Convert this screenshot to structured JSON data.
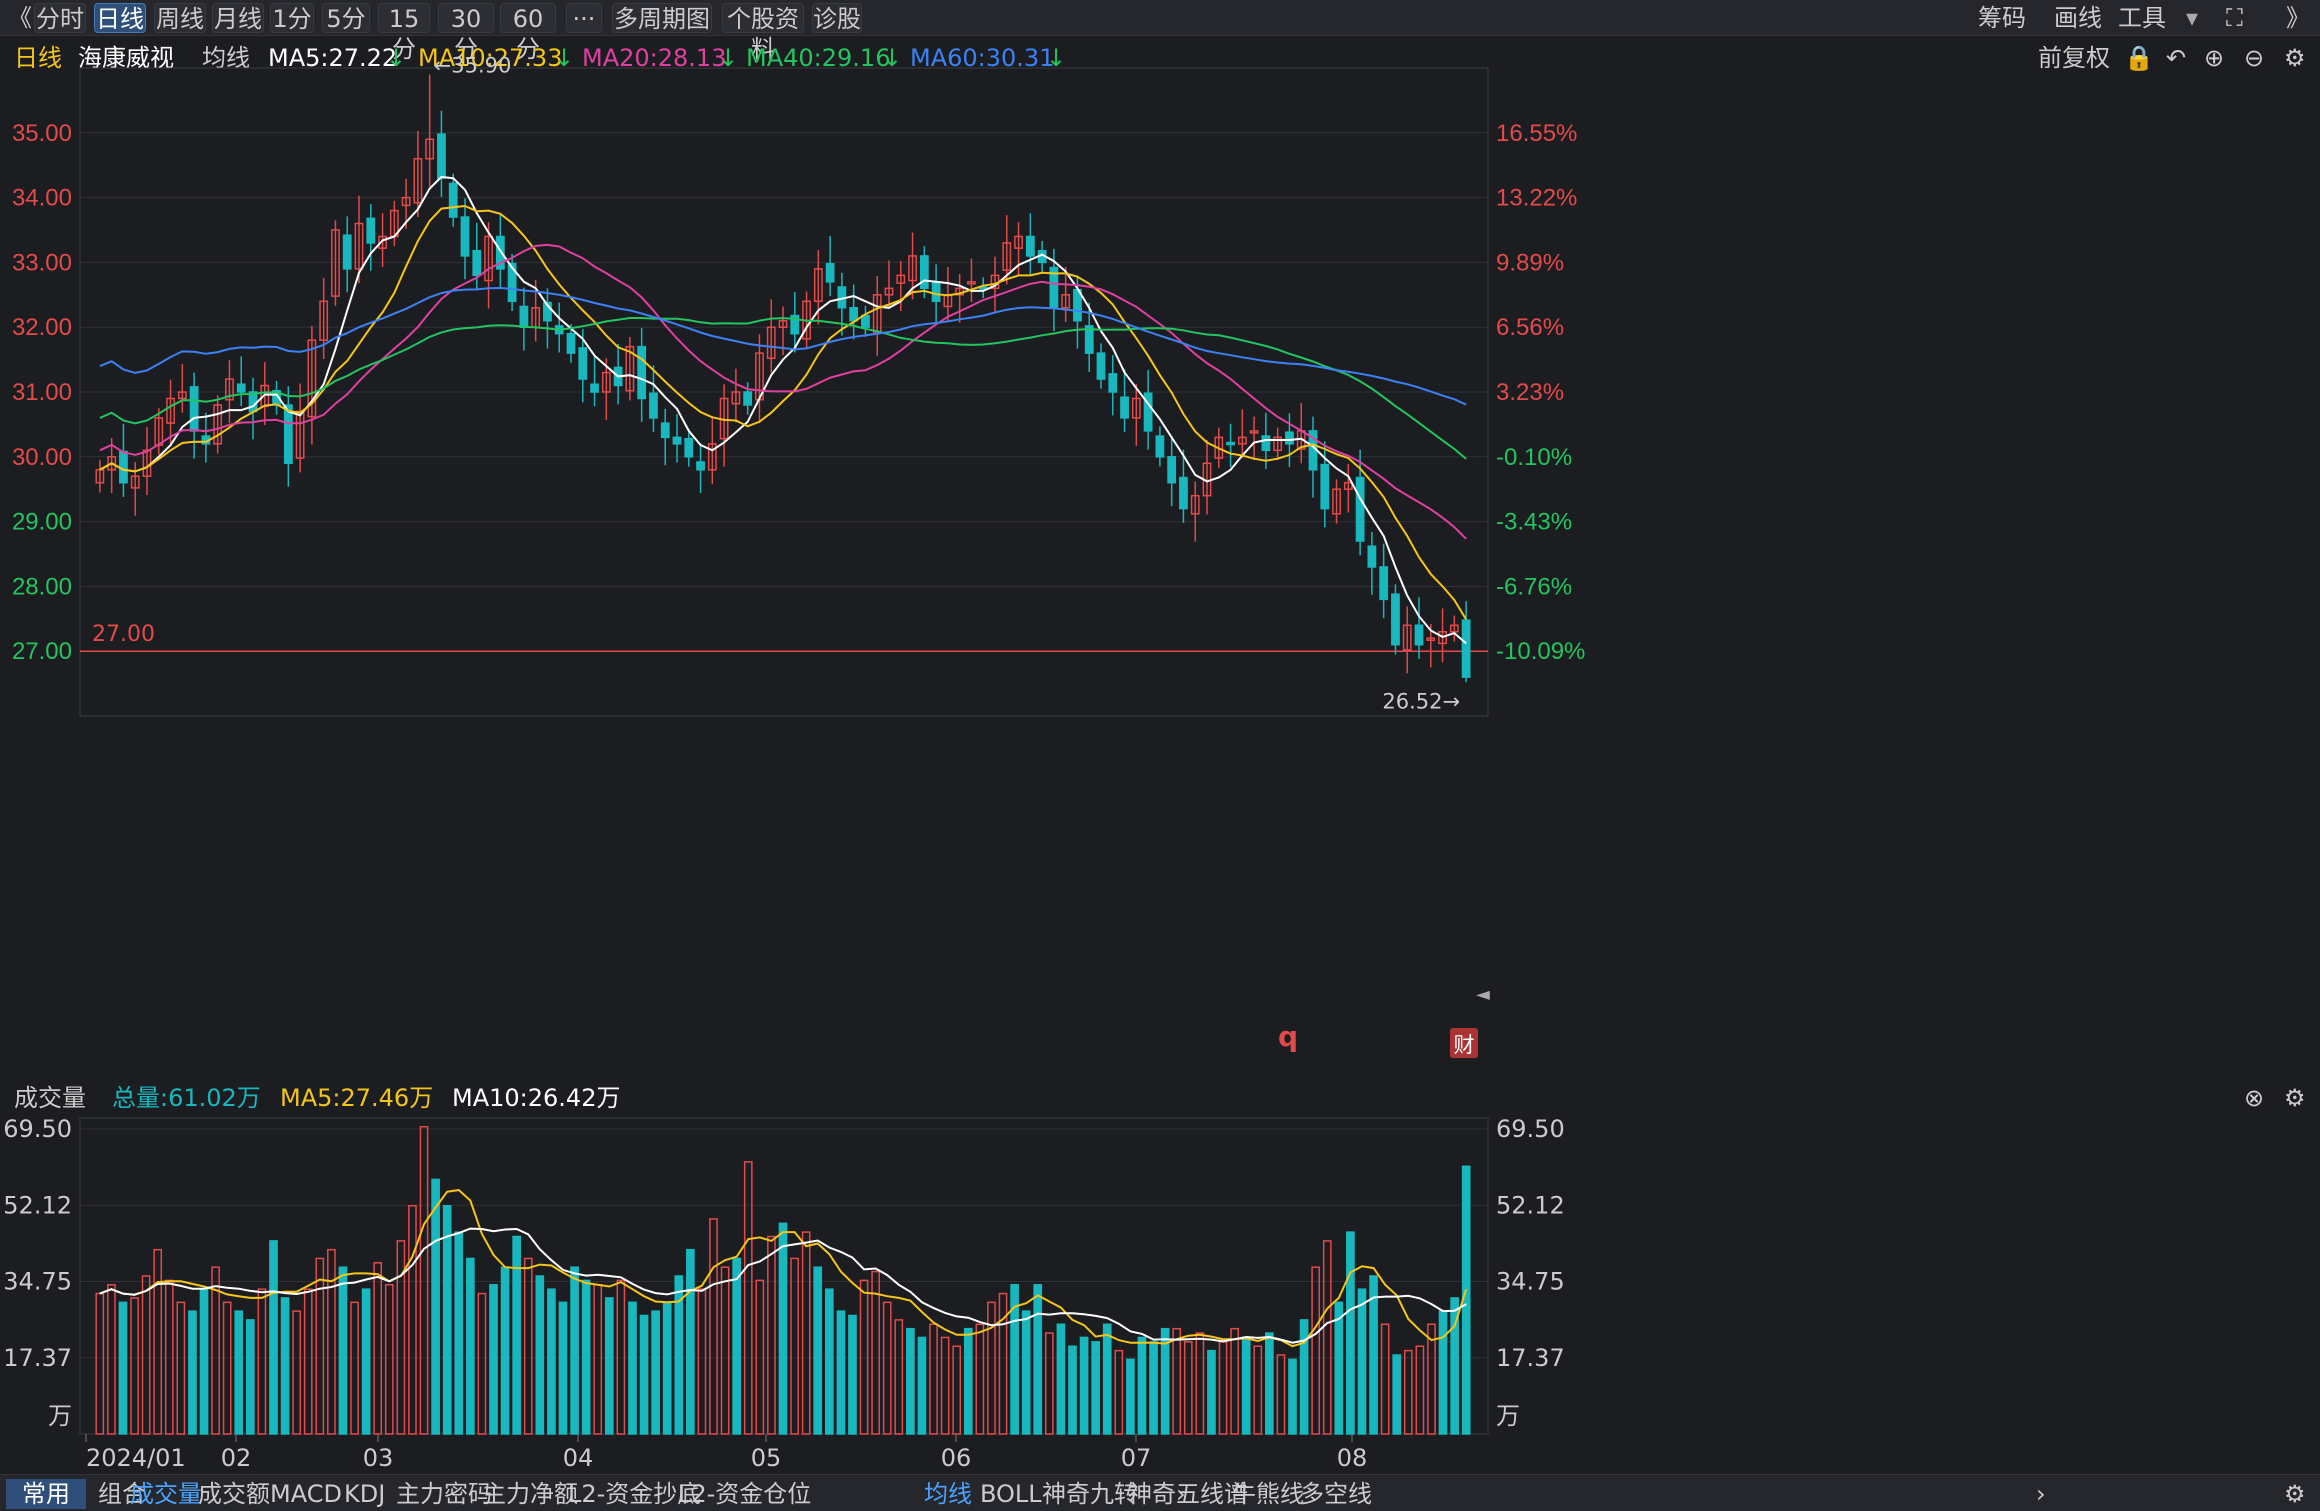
{
  "toolbar": {
    "tabs": [
      "分时",
      "日线",
      "周线",
      "月线",
      "1分",
      "5分",
      "15分",
      "30分",
      "60分",
      "···",
      "多周期图",
      "个股资料",
      "诊股"
    ],
    "active": "日线",
    "right": [
      "筹码",
      "画线",
      "工具"
    ]
  },
  "header": {
    "period": "日线",
    "stock": "海康威视",
    "ma_label": "均线",
    "ma5": "MA5:27.22",
    "ma10": "MA10:27.33",
    "ma20": "MA20:28.13",
    "ma40": "MA40:29.16",
    "ma60": "MA60:30.31",
    "fq": "前复权"
  },
  "colors": {
    "up": "#e34a4a",
    "down": "#19b7be",
    "ma5": "#ffffff",
    "ma10": "#f5c518",
    "ma20": "#e040a0",
    "ma40": "#22c55e",
    "ma60": "#3b82f6"
  },
  "vol_header": {
    "label": "成交量",
    "total": "总量:61.02万",
    "ma5": "MA5:27.46万",
    "ma10": "MA10:26.42万"
  },
  "annotations": {
    "high": "←35.90",
    "low": "26.52→",
    "line": "27.00",
    "marker": "q",
    "badge": "财"
  },
  "bottom": {
    "left": [
      "常用",
      "组合"
    ],
    "indicators": [
      "成交量",
      "成交额",
      "MACD",
      "KDJ",
      "主力密码",
      "主力净额",
      "L2-资金抄底",
      "L2-资金仓位"
    ],
    "right": [
      "均线",
      "BOLL",
      "神奇九转",
      "神奇五线谱",
      "牛熊线",
      "多空线"
    ]
  },
  "chart_data": {
    "type": "candlestick",
    "price_axis": {
      "ticks": [
        "35.00",
        "34.00",
        "33.00",
        "32.00",
        "31.00",
        "30.00",
        "29.00",
        "28.00",
        "27.00"
      ],
      "pct_ticks": [
        "16.55%",
        "13.22%",
        "9.89%",
        "6.56%",
        "3.23%",
        "-0.10%",
        "-3.43%",
        "-6.76%",
        "-10.09%"
      ],
      "range": [
        26.0,
        36.0
      ],
      "ref_line": 27.0
    },
    "vol_axis": {
      "ticks": [
        "69.50",
        "52.12",
        "34.75",
        "17.37"
      ],
      "unit": "万"
    },
    "x_labels": [
      "2024/01",
      "02",
      "03",
      "04",
      "05",
      "06",
      "07",
      "08"
    ],
    "close": [
      29.8,
      30.0,
      29.6,
      29.7,
      30.1,
      30.6,
      30.9,
      31.0,
      30.4,
      30.2,
      30.8,
      31.2,
      31.0,
      30.7,
      31.1,
      30.8,
      29.9,
      30.7,
      31.8,
      32.4,
      33.5,
      32.9,
      33.6,
      33.3,
      33.4,
      33.8,
      34.0,
      34.6,
      34.9,
      34.3,
      33.7,
      33.1,
      32.8,
      33.4,
      32.9,
      32.4,
      32.0,
      32.3,
      32.1,
      31.9,
      31.6,
      31.2,
      31.0,
      31.3,
      31.1,
      31.7,
      30.9,
      30.6,
      30.3,
      30.2,
      30.0,
      29.8,
      30.2,
      30.9,
      31.0,
      30.8,
      31.6,
      32.0,
      32.1,
      31.9,
      32.4,
      32.9,
      32.7,
      32.3,
      32.1,
      32.0,
      32.5,
      32.6,
      32.8,
      33.1,
      32.6,
      32.4,
      32.5,
      32.6,
      32.7,
      32.6,
      32.8,
      33.3,
      33.4,
      33.1,
      33.0,
      32.3,
      32.5,
      32.1,
      31.6,
      31.2,
      31.0,
      30.6,
      30.9,
      30.4,
      30.0,
      29.6,
      29.2,
      29.4,
      29.9,
      30.3,
      30.2,
      30.3,
      30.4,
      30.1,
      30.3,
      30.2,
      30.4,
      29.8,
      29.2,
      29.5,
      29.6,
      28.7,
      28.3,
      27.8,
      27.1,
      27.4,
      27.1,
      27.2,
      27.3,
      27.4,
      26.6
    ],
    "volume": [
      32,
      34,
      30,
      31,
      36,
      42,
      35,
      30,
      28,
      33,
      38,
      30,
      28,
      26,
      33,
      44,
      31,
      28,
      33,
      40,
      42,
      38,
      30,
      33,
      39,
      34,
      44,
      52,
      70,
      58,
      52,
      46,
      40,
      32,
      34,
      38,
      45,
      40,
      36,
      33,
      30,
      38,
      35,
      34,
      31,
      35,
      30,
      27,
      28,
      30,
      36,
      42,
      33,
      49,
      38,
      40,
      62,
      35,
      45,
      48,
      40,
      46,
      38,
      33,
      28,
      27,
      35,
      37,
      30,
      26,
      24,
      22,
      25,
      22,
      20,
      24,
      25,
      30,
      32,
      34,
      28,
      34,
      23,
      25,
      20,
      22,
      21,
      25,
      19,
      17,
      22,
      21,
      24,
      24,
      21,
      23,
      19,
      21,
      24,
      22,
      20,
      23,
      18,
      17,
      26,
      38,
      44,
      30,
      46,
      33,
      36,
      25,
      18,
      19,
      20,
      25,
      28,
      31,
      61
    ],
    "series": [
      {
        "name": "MA5"
      },
      {
        "name": "MA10"
      },
      {
        "name": "MA20"
      },
      {
        "name": "MA40"
      },
      {
        "name": "MA60"
      }
    ]
  }
}
